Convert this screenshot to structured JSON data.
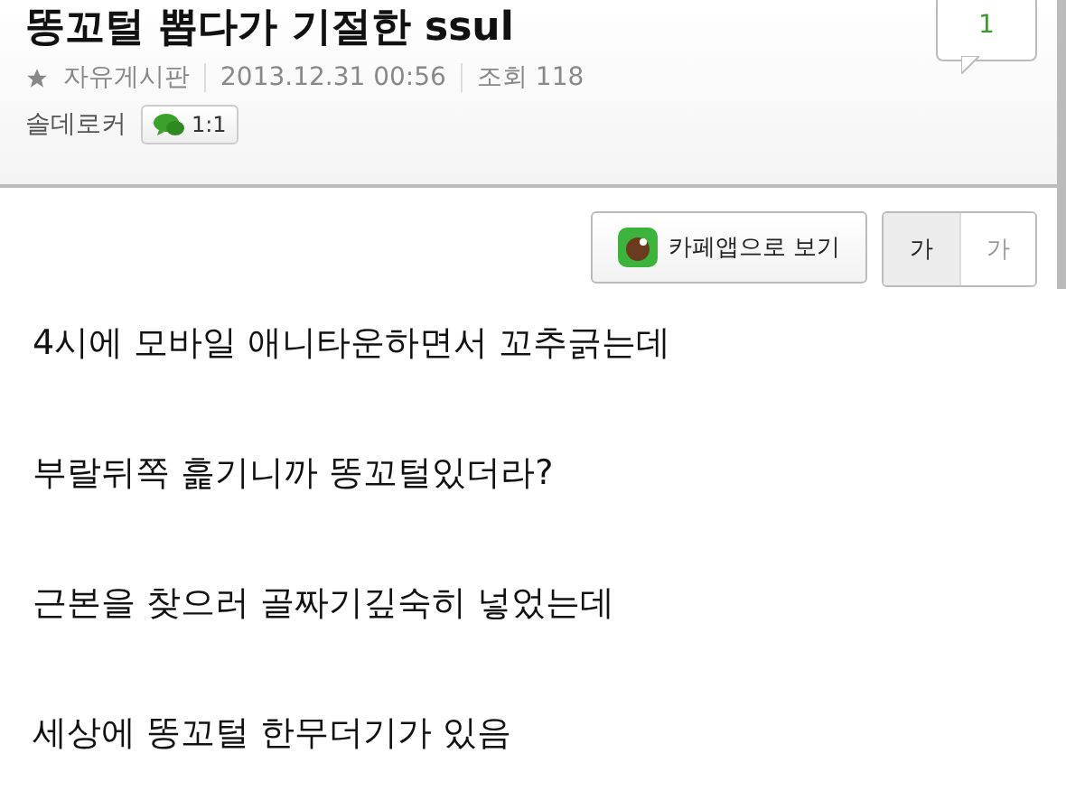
{
  "post": {
    "title": "똥꼬털 뽑다가 기절한 ssul",
    "board": "자유게시판",
    "date": "2013.12.31 00:56",
    "views": "조회 118",
    "author": "솔데로커",
    "chat_button": "1:1",
    "comment_count": "1"
  },
  "toolbar": {
    "app_button": "카페앱으로 보기",
    "font_sizes": [
      {
        "label": "가",
        "selected": true
      },
      {
        "label": "가",
        "selected": false
      }
    ]
  },
  "body": [
    "4시에 모바일 애니타운하면서 꼬추긁는데",
    "부랄뒤쪽 흝기니까 똥꼬털있더라?",
    "근본을 찾으러 골짜기깊숙히 넣었는데",
    "세상에 똥꼬털 한무더기가 있음"
  ]
}
